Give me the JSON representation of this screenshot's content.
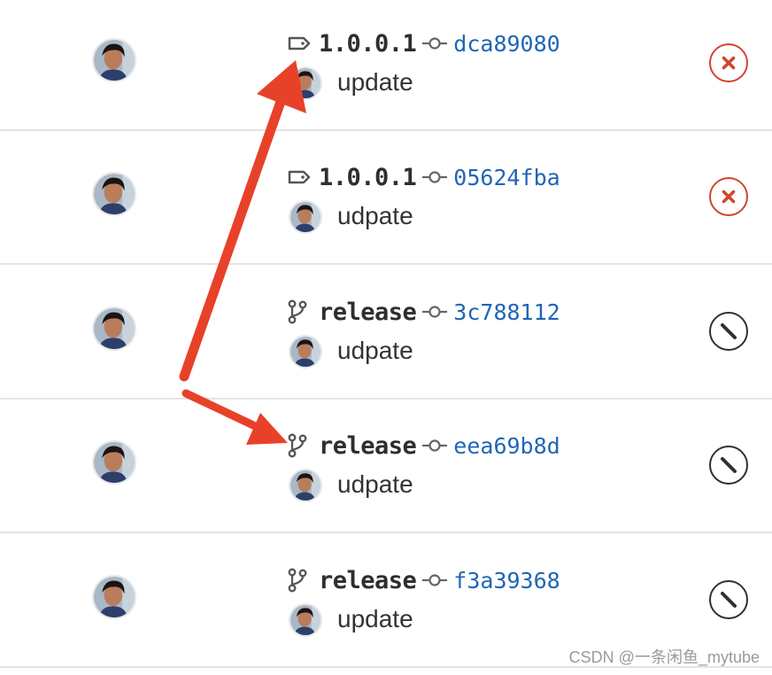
{
  "pipelines": [
    {
      "ref_type": "tag",
      "ref_icon": "tag-icon",
      "ref": "1.0.0.1",
      "commit_icon": "commit-icon",
      "sha": "dca89080",
      "message": "update",
      "status": "failed",
      "status_icon": "close-icon"
    },
    {
      "ref_type": "tag",
      "ref_icon": "tag-icon",
      "ref": "1.0.0.1",
      "commit_icon": "commit-icon",
      "sha": "05624fba",
      "message": "udpate",
      "status": "failed",
      "status_icon": "close-icon"
    },
    {
      "ref_type": "branch",
      "ref_icon": "branch-icon",
      "ref": "release",
      "commit_icon": "commit-icon",
      "sha": "3c788112",
      "message": "udpate",
      "status": "canceled",
      "status_icon": "cancel-icon"
    },
    {
      "ref_type": "branch",
      "ref_icon": "branch-icon",
      "ref": "release",
      "commit_icon": "commit-icon",
      "sha": "eea69b8d",
      "message": "udpate",
      "status": "canceled",
      "status_icon": "cancel-icon"
    },
    {
      "ref_type": "branch",
      "ref_icon": "branch-icon",
      "ref": "release",
      "commit_icon": "commit-icon",
      "sha": "f3a39368",
      "message": "update",
      "status": "canceled",
      "status_icon": "cancel-icon"
    }
  ],
  "colors": {
    "link": "#1f66b5",
    "failed": "#d0462e",
    "canceled": "#303030",
    "annotation_arrow": "#e8412a",
    "divider": "#e4e4e4"
  },
  "watermark": "CSDN @一条闲鱼_mytube"
}
